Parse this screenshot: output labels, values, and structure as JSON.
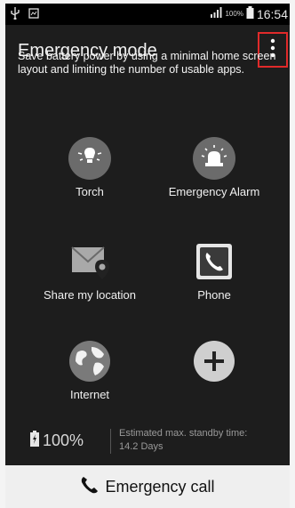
{
  "status_bar": {
    "battery_percent": "100%",
    "time": "16:54"
  },
  "header": {
    "title": "Emergency mode"
  },
  "description": "Save battery power by using a minimal home screen layout and limiting the number of usable apps.",
  "apps": [
    {
      "label": "Torch",
      "icon": "torch-icon"
    },
    {
      "label": "Emergency Alarm",
      "icon": "alarm-icon"
    },
    {
      "label": "Share my location",
      "icon": "location-icon"
    },
    {
      "label": "Phone",
      "icon": "phone-icon"
    },
    {
      "label": "Internet",
      "icon": "globe-icon"
    },
    {
      "label": "",
      "icon": "plus-icon"
    }
  ],
  "battery_info": {
    "percent": "100%",
    "standby_label": "Estimated max. standby time:",
    "standby_value": "14.2 Days"
  },
  "emergency_call": {
    "label": "Emergency call"
  },
  "colors": {
    "background": "#1d1d1d",
    "highlight_border": "#e02a2a",
    "icon_circle": "#6b6b6b"
  }
}
